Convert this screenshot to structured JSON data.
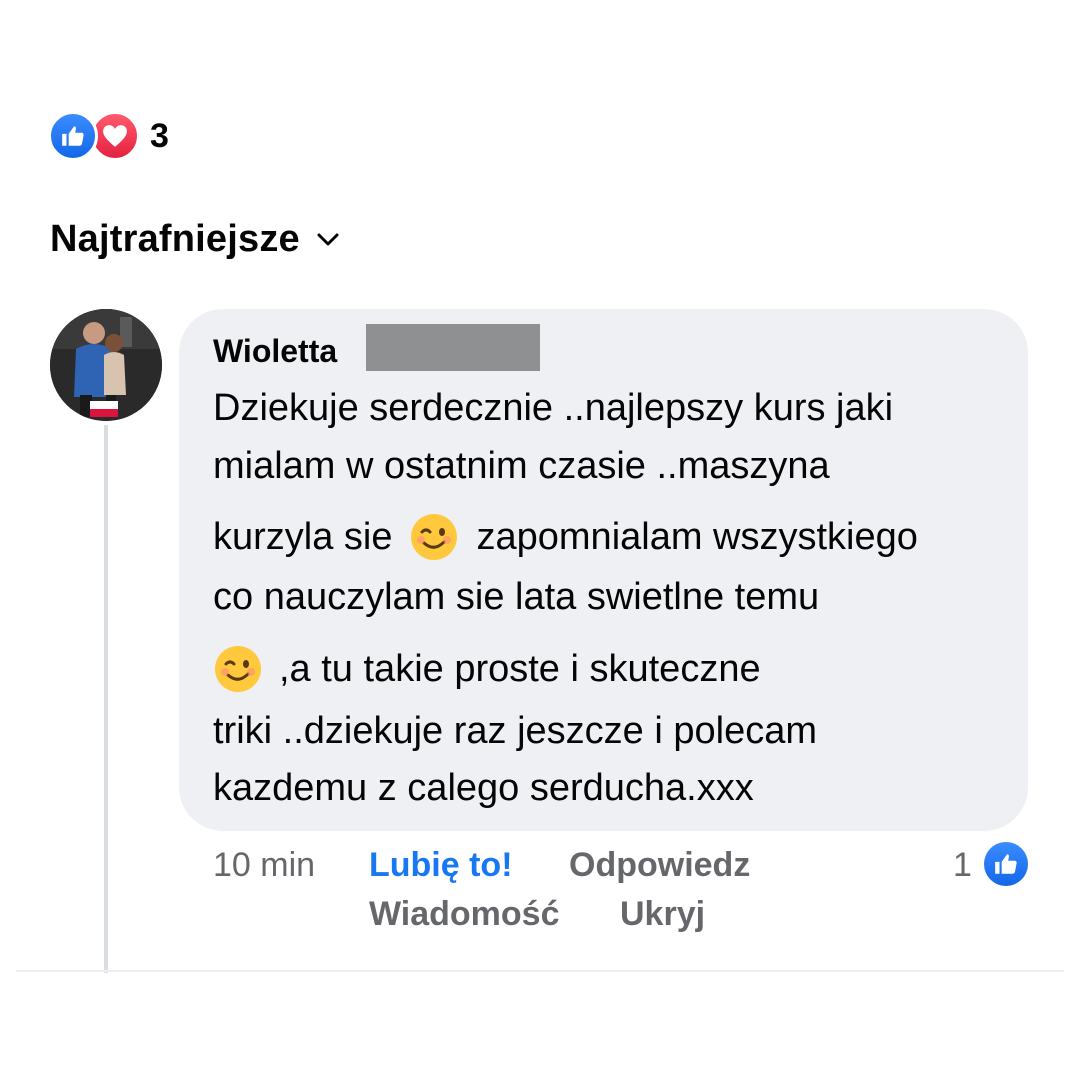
{
  "reactions": {
    "icons": [
      "like-icon",
      "love-icon"
    ],
    "count": "3",
    "like_color": "#1877F2",
    "love_color": "#F33E58"
  },
  "sort": {
    "label": "Najtrafniejsze",
    "icon": "chevron-down-icon"
  },
  "comment": {
    "author": "Wioletta",
    "lines": [
      "Dziekuje serdecznie ..najlepszy kurs jaki",
      "mialam w ostatnim czasie ..maszyna",
      "kurzyla sie",
      "zapomnialam wszystkiego",
      "co nauczylam sie lata swietlne temu",
      ",a tu takie proste i skuteczne",
      "triki ..dziekuje raz jeszcze i polecam",
      "kazdemu z calego serducha.xxx"
    ],
    "emoji": "winking-face-emoji",
    "bubble_color": "#EEF0F4"
  },
  "actions": {
    "time": "10 min",
    "like_label": "Lubię to!",
    "reply_label": "Odpowiedz",
    "message_label": "Wiadomość",
    "hide_label": "Ukryj",
    "like_count": "1",
    "accent": "#1877F2"
  }
}
